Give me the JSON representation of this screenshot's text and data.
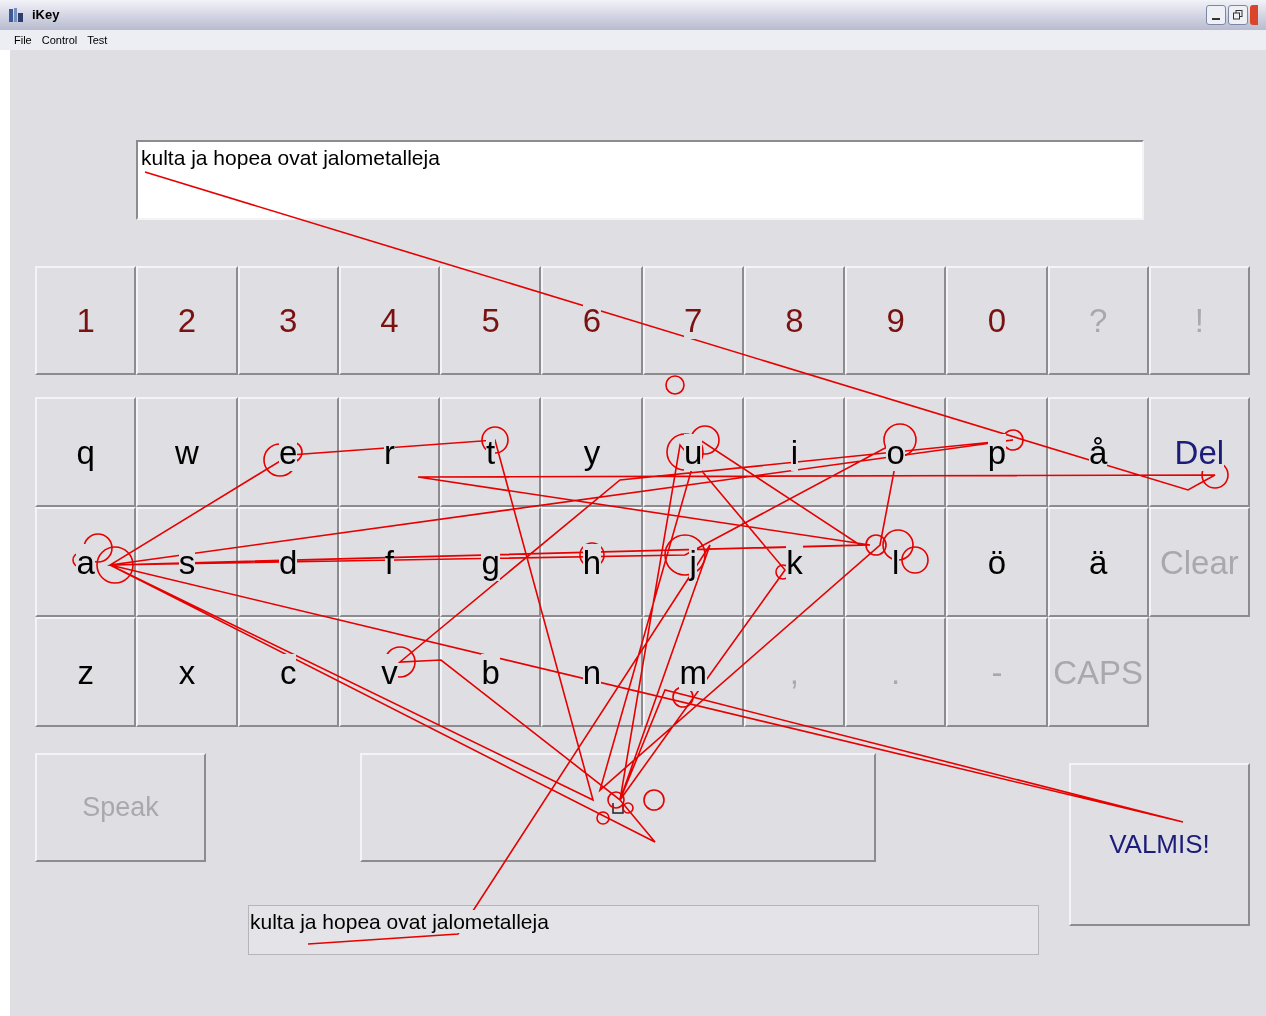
{
  "window": {
    "title": "iKey"
  },
  "menu": [
    "File",
    "Control",
    "Test"
  ],
  "text_display": {
    "value": "kulta ja hopea ovat jalometalleja"
  },
  "keyboard": {
    "rows": [
      [
        {
          "label": "1",
          "kind": "digit"
        },
        {
          "label": "2",
          "kind": "digit"
        },
        {
          "label": "3",
          "kind": "digit"
        },
        {
          "label": "4",
          "kind": "digit"
        },
        {
          "label": "5",
          "kind": "digit"
        },
        {
          "label": "6",
          "kind": "digit"
        },
        {
          "label": "7",
          "kind": "digit"
        },
        {
          "label": "8",
          "kind": "digit"
        },
        {
          "label": "9",
          "kind": "digit"
        },
        {
          "label": "0",
          "kind": "digit"
        },
        {
          "label": "?",
          "kind": "inactive"
        },
        {
          "label": "!",
          "kind": "inactive"
        }
      ],
      [
        {
          "label": "q",
          "kind": "letter"
        },
        {
          "label": "w",
          "kind": "letter"
        },
        {
          "label": "e",
          "kind": "letter"
        },
        {
          "label": "r",
          "kind": "letter"
        },
        {
          "label": "t",
          "kind": "letter"
        },
        {
          "label": "y",
          "kind": "letter"
        },
        {
          "label": "u",
          "kind": "letter"
        },
        {
          "label": "i",
          "kind": "letter"
        },
        {
          "label": "o",
          "kind": "letter"
        },
        {
          "label": "p",
          "kind": "letter"
        },
        {
          "label": "å",
          "kind": "letter"
        },
        {
          "label": "Del",
          "kind": "command"
        }
      ],
      [
        {
          "label": "a",
          "kind": "letter"
        },
        {
          "label": "s",
          "kind": "letter"
        },
        {
          "label": "d",
          "kind": "letter"
        },
        {
          "label": "f",
          "kind": "letter"
        },
        {
          "label": "g",
          "kind": "letter"
        },
        {
          "label": "h",
          "kind": "letter"
        },
        {
          "label": "j",
          "kind": "letter"
        },
        {
          "label": "k",
          "kind": "letter"
        },
        {
          "label": "l",
          "kind": "letter"
        },
        {
          "label": "ö",
          "kind": "letter"
        },
        {
          "label": "ä",
          "kind": "letter"
        },
        {
          "label": "Clear",
          "kind": "inactive"
        }
      ],
      [
        {
          "label": "z",
          "kind": "letter"
        },
        {
          "label": "x",
          "kind": "letter"
        },
        {
          "label": "c",
          "kind": "letter"
        },
        {
          "label": "v",
          "kind": "letter"
        },
        {
          "label": "b",
          "kind": "letter"
        },
        {
          "label": "n",
          "kind": "letter"
        },
        {
          "label": "m",
          "kind": "letter"
        },
        {
          "label": ",",
          "kind": "inactive"
        },
        {
          "label": ".",
          "kind": "inactive"
        },
        {
          "label": "-",
          "kind": "inactive"
        },
        {
          "label": "CAPS",
          "kind": "inactive"
        }
      ]
    ]
  },
  "speak_button": {
    "label": "Speak",
    "disabled": true
  },
  "done_button": {
    "label": "VALMIS!"
  },
  "output_field": {
    "value": "kulta ja hopea ovat jalometalleja"
  }
}
